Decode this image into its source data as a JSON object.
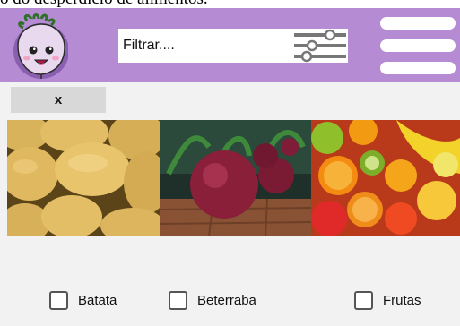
{
  "page": {
    "partial_title": "o do desperdício de alimentos."
  },
  "header": {
    "logo_icon": "beet-mascot-logo",
    "background": "#b58bd3",
    "search": {
      "placeholder": "Filtrar....",
      "value": ""
    },
    "filter_icon": "sliders-filter-icon",
    "menu_icon": "hamburger-menu-icon"
  },
  "close_button": {
    "label": "x"
  },
  "images": [
    {
      "name": "batata-image",
      "subject": "potatoes"
    },
    {
      "name": "beterraba-image",
      "subject": "beets"
    },
    {
      "name": "frutas-image",
      "subject": "fruits"
    }
  ],
  "filters": [
    {
      "label": "Batata",
      "checked": false
    },
    {
      "label": "Beterraba",
      "checked": false
    },
    {
      "label": "Frutas",
      "checked": false
    }
  ]
}
